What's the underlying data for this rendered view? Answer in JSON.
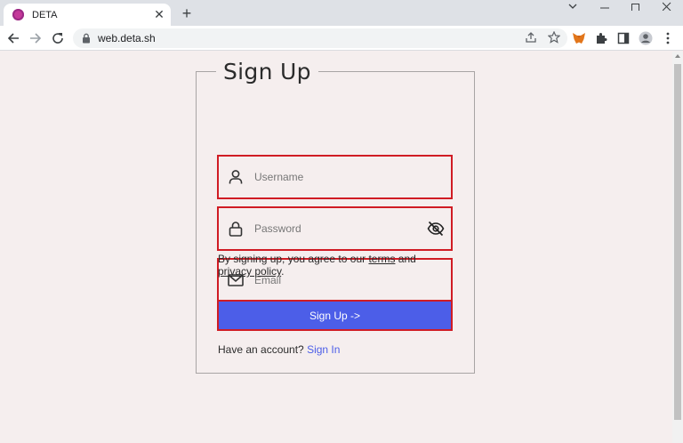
{
  "browser": {
    "tab_title": "DETA",
    "tab_close": "✕",
    "new_tab": "+",
    "url": "web.deta.sh",
    "icons": [
      "back-icon",
      "forward-icon",
      "reload-icon",
      "lock-icon",
      "share-icon",
      "star-icon",
      "metamask-icon",
      "extensions-icon",
      "side-panel-icon",
      "profile-icon",
      "menu-icon"
    ]
  },
  "form": {
    "title": "Sign Up",
    "username_placeholder": "Username",
    "password_placeholder": "Password",
    "email_placeholder": "Email",
    "terms_prefix": "By signing up, you agree to our ",
    "terms_link": "terms",
    "terms_and": " and",
    "privacy_link": "privacy policy",
    "terms_suffix": ".",
    "submit_label": "Sign Up ->",
    "have_account": "Have an account? ",
    "signin_link": "Sign In"
  },
  "colors": {
    "accent": "#4c5ee8",
    "highlight_border": "#d01c24",
    "page_bg": "#f5eeee"
  }
}
